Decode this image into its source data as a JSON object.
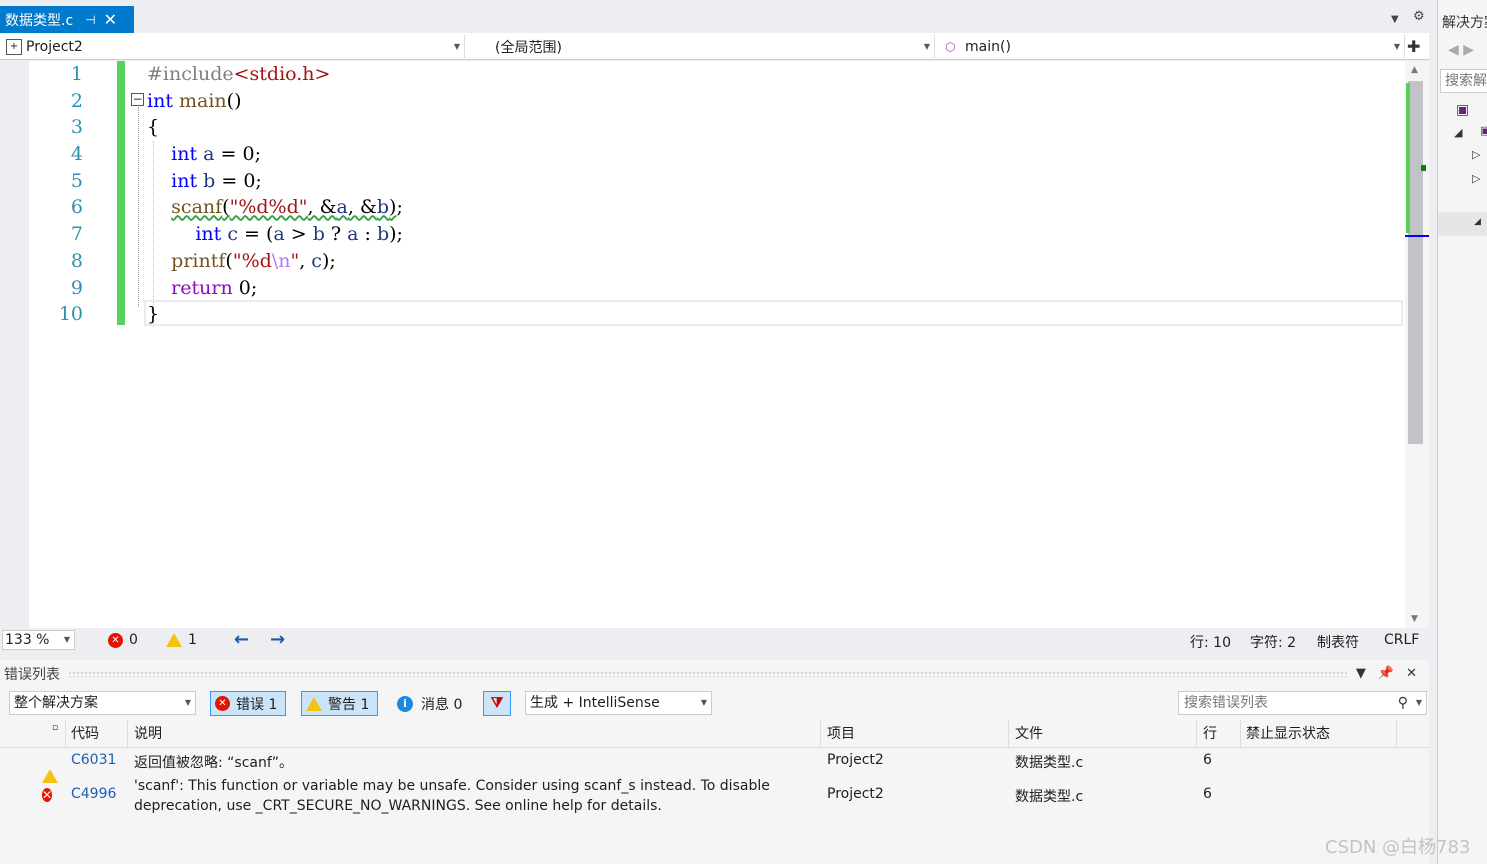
{
  "tab": {
    "title": "数据类型.c",
    "pin": "⊣",
    "close": "✕"
  },
  "navbar": {
    "project": "Project2",
    "scope": "(全局范围)",
    "member": "main()"
  },
  "editor": {
    "line_numbers": [
      "1",
      "2",
      "3",
      "4",
      "5",
      "6",
      "7",
      "8",
      "9",
      "10"
    ],
    "lines": {
      "l1": {
        "pp": "#include",
        "inc": "<stdio.h>"
      },
      "l2": {
        "kw": "int",
        "fn": " main",
        "rest": "()"
      },
      "l3": {
        "text": "{"
      },
      "l4": {
        "indent": "    ",
        "kw": "int",
        "vr": " a",
        "rest": " = 0;"
      },
      "l5": {
        "indent": "    ",
        "kw": "int",
        "vr": " b",
        "rest": " = 0;"
      },
      "l6": {
        "indent": "    ",
        "fn": "scanf",
        "p1": "(",
        "str": "\"%d%d\"",
        "p2": ", &",
        "v1": "a",
        "p3": ", &",
        "v2": "b",
        "p4": ")",
        "rest": ";"
      },
      "l7": {
        "indent": "        ",
        "kw": "int",
        "vr": " c",
        "p1": " = (",
        "v1": "a",
        "p2": " > ",
        "v2": "b",
        "p3": " ? ",
        "v3": "a",
        "p4": " : ",
        "v4": "b",
        "rest": ");"
      },
      "l8": {
        "indent": "    ",
        "fn": "printf",
        "p1": "(",
        "str1": "\"%d",
        "esc": "\\n",
        "str2": "\"",
        "p2": ", ",
        "v1": "c",
        "rest": ");"
      },
      "l9": {
        "indent": "    ",
        "ret": "return",
        "rest": " 0;"
      },
      "l10": {
        "text": "}"
      }
    }
  },
  "status": {
    "zoom": "133 %",
    "errors": "0",
    "warnings": "1",
    "line": "行: 10",
    "char": "字符: 2",
    "tabs": "制表符",
    "eol": "CRLF"
  },
  "error_list": {
    "title": "错误列表",
    "scope": "整个解决方案",
    "errors_btn": "错误 1",
    "warnings_btn": "警告 1",
    "messages_btn": "消息 0",
    "build_filter": "生成 + IntelliSense",
    "search_placeholder": "搜索错误列表",
    "columns": [
      "代码",
      "说明",
      "项目",
      "文件",
      "行",
      "禁止显示状态"
    ],
    "rows": [
      {
        "severity": "warning",
        "code": "C6031",
        "desc": "返回值被忽略: “scanf”。",
        "project": "Project2",
        "file": "数据类型.c",
        "line": "6"
      },
      {
        "severity": "error",
        "code": "C4996",
        "desc": "'scanf': This function or variable may be unsafe. Consider using scanf_s instead. To disable deprecation, use _CRT_SECURE_NO_WARNINGS. See online help for details.",
        "project": "Project2",
        "file": "数据类型.c",
        "line": "6"
      }
    ]
  },
  "solution_panel": {
    "title": "解决方案",
    "search": "搜索解决方案"
  },
  "watermark": "CSDN @白杨783"
}
